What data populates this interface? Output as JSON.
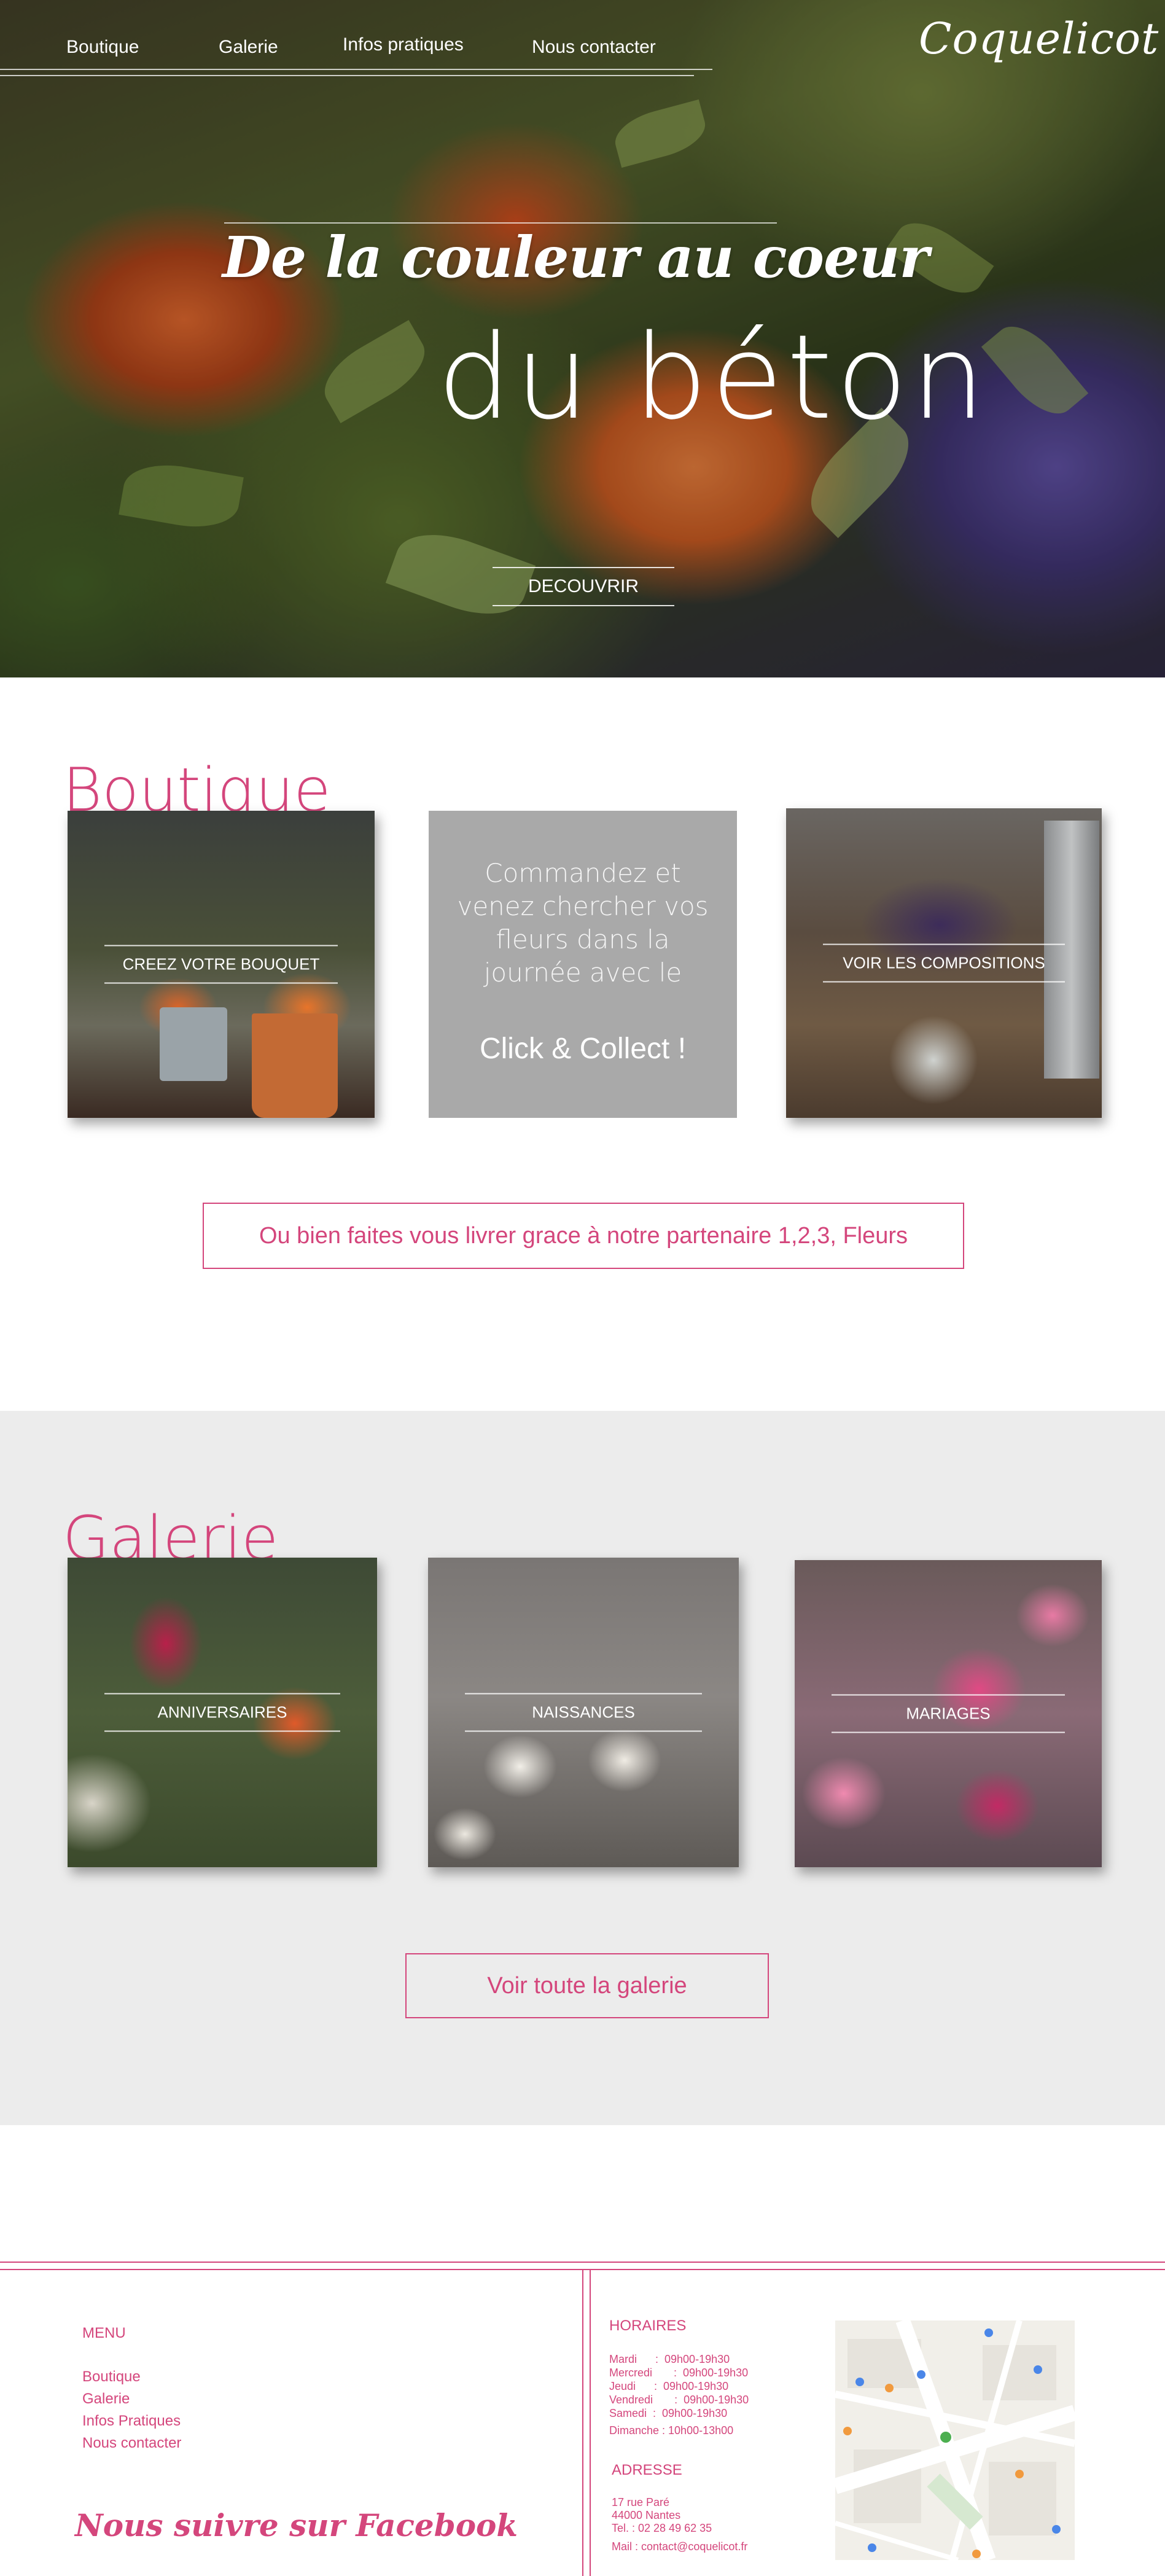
{
  "nav": {
    "items": [
      "Boutique",
      "Galerie",
      "Infos pratiques",
      "Nous contacter"
    ]
  },
  "brand": {
    "logo": "Coquelicot"
  },
  "hero": {
    "title_line1": "De la couleur au coeur",
    "title_line2": "du béton",
    "cta": "DECOUVRIR"
  },
  "boutique": {
    "title": "Boutique",
    "tile_bouquet": "CREEZ VOTRE BOUQUET",
    "promo_text": "Commandez et venez chercher vos fleurs dans la journée avec le",
    "promo_emphasis": "Click & Collect !",
    "tile_compositions": "VOIR LES COMPOSITIONS",
    "delivery_button": "Ou bien faites vous livrer grace à notre partenaire 1,2,3, Fleurs"
  },
  "galerie": {
    "title": "Galerie",
    "tiles": [
      "ANNIVERSAIRES",
      "NAISSANCES",
      "MARIAGES"
    ],
    "all_button": "Voir toute la galerie"
  },
  "footer": {
    "menu_title": "MENU",
    "menu_items": [
      "Boutique",
      "Galerie",
      "Infos Pratiques",
      "Nous contacter"
    ],
    "facebook": "Nous suivre sur Facebook",
    "hours_title": "HORAIRES",
    "hours": [
      "Mardi      :  09h00-19h30",
      "Mercredi       :  09h00-19h30",
      "Jeudi      :  09h00-19h30",
      "Vendredi       :  09h00-19h30",
      "Samedi  :  09h00-19h30",
      "Dimanche : 10h00-13h00"
    ],
    "address_title": "ADRESSE",
    "address": [
      "17 rue Paré",
      "44000 Nantes",
      "Tel. : 02 28 49 62 35",
      "Mail : contact@coquelicot.fr"
    ]
  },
  "colors": {
    "accent": "#d4467c",
    "promo_grey": "#a9a9a9",
    "gallery_bg": "#ececec"
  }
}
